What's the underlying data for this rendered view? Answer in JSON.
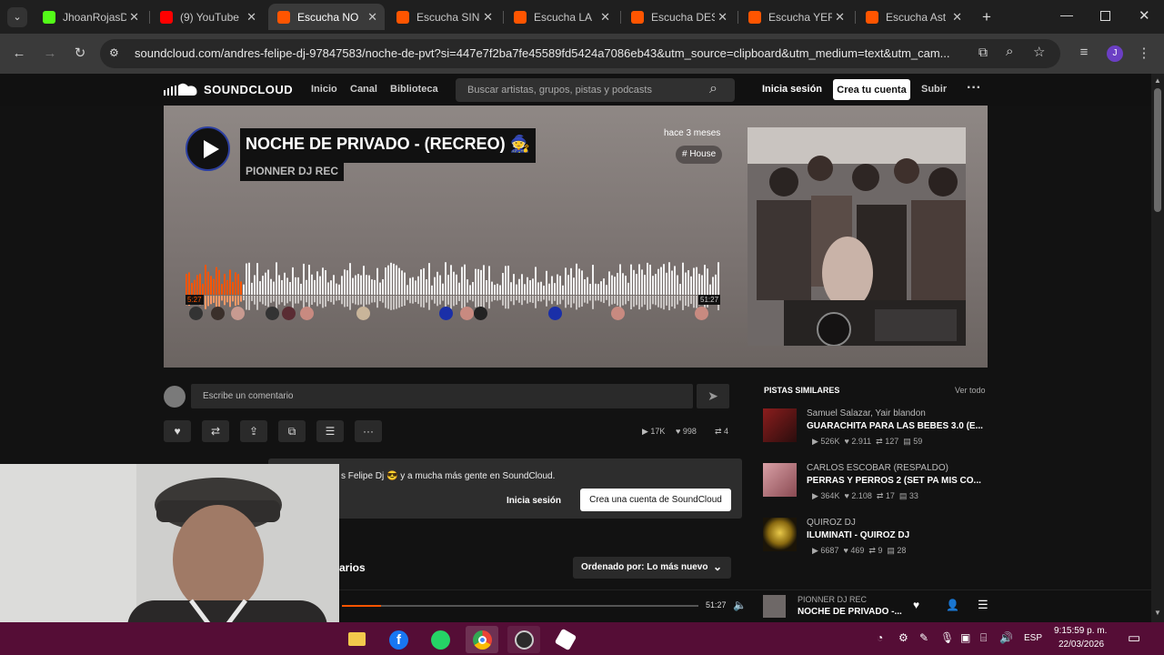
{
  "browser": {
    "tabs": [
      {
        "title": "JhoanRojasD",
        "favicon_color": "#53fc18"
      },
      {
        "title": "(9) YouTube",
        "favicon_color": "#ff0000"
      },
      {
        "title": "Escucha NO",
        "favicon_color": "#ff5500"
      },
      {
        "title": "Escucha SIN",
        "favicon_color": "#ff5500"
      },
      {
        "title": "Escucha LA",
        "favicon_color": "#ff5500"
      },
      {
        "title": "Escucha DES",
        "favicon_color": "#ff5500"
      },
      {
        "title": "Escucha YER",
        "favicon_color": "#ff5500"
      },
      {
        "title": "Escucha Ast",
        "favicon_color": "#ff5500"
      }
    ],
    "url": "soundcloud.com/andres-felipe-dj-97847583/noche-de-pvt?si=447e7f2ba7fe45589fd5424a7086eb43&utm_source=clipboard&utm_medium=text&utm_cam...",
    "profile_initial": "J"
  },
  "soundcloud": {
    "logo": "SOUNDCLOUD",
    "nav": {
      "home": "Inicio",
      "feed": "Canal",
      "library": "Biblioteca"
    },
    "search_placeholder": "Buscar artistas, grupos, pistas y podcasts",
    "signin": "Inicia sesión",
    "create_account": "Crea tu cuenta",
    "upload": "Subir"
  },
  "track": {
    "title": "NOCHE DE PRIVADO - (RECREO) 🧙",
    "artist": "PIONNER DJ REC",
    "posted": "hace 3 meses",
    "tag": "# House",
    "time_current": "5:27",
    "time_total": "51:27",
    "progress": 0.107
  },
  "comment": {
    "placeholder": "Escribe un comentario"
  },
  "stats": {
    "plays": "17K",
    "likes": "998",
    "reposts": "4"
  },
  "banner": {
    "text": "s Felipe Dj 😎 y a mucha más gente en SoundCloud.",
    "signin": "Inicia sesión",
    "create": "Crea una cuenta de SoundCloud"
  },
  "similar": {
    "title": "PISTAS SIMILARES",
    "see_all": "Ver todo",
    "items": [
      {
        "artist": "Samuel Salazar, Yair blandon",
        "name": "GUARACHITA PARA LAS BEBES 3.0 (E...",
        "plays": "526K",
        "likes": "2.911",
        "reposts": "127",
        "comments": "59"
      },
      {
        "artist": "CARLOS ESCOBAR (RESPALDO)",
        "name": "PERRAS Y PERROS 2 (SET PA MIS CO...",
        "plays": "364K",
        "likes": "2.108",
        "reposts": "17",
        "comments": "33"
      },
      {
        "artist": "QUIROZ DJ",
        "name": "ILUMINATI - QUIROZ DJ",
        "plays": "6687",
        "likes": "469",
        "reposts": "9",
        "comments": "28"
      }
    ]
  },
  "comments_section": {
    "title_fragment": "arios",
    "sort": "Ordenado por: Lo más nuevo"
  },
  "player": {
    "time": "51:27",
    "artist": "PIONNER DJ REC",
    "title": "NOCHE DE PRIVADO -..."
  },
  "taskbar": {
    "lang": "ESP",
    "time": "9:15:59 p. m.",
    "date": "22/03/2026"
  }
}
